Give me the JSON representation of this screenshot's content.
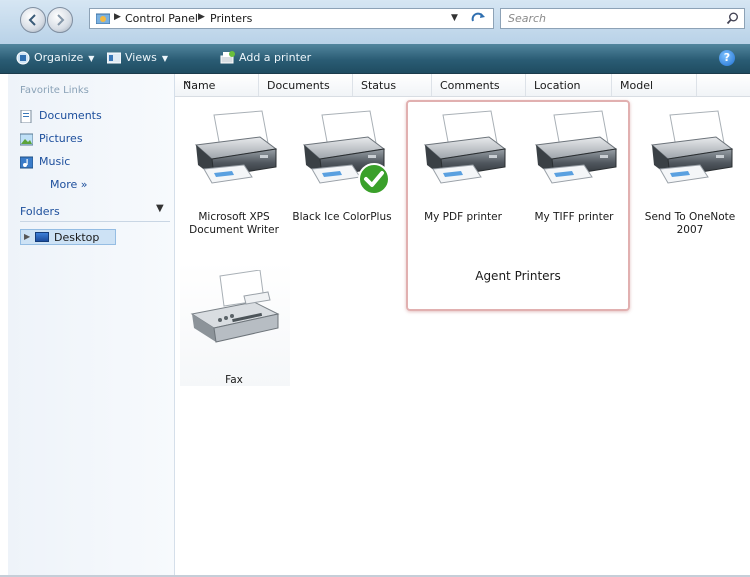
{
  "address_bar": {
    "breadcrumbs": [
      "Control Panel",
      "Printers"
    ],
    "search_placeholder": "Search"
  },
  "toolbar": {
    "organize_label": "Organize",
    "views_label": "Views",
    "add_printer_label": "Add a printer"
  },
  "nav_pane": {
    "favorite_links_header": "Favorite Links",
    "links": [
      {
        "label": "Documents",
        "icon": "documents-icon"
      },
      {
        "label": "Pictures",
        "icon": "pictures-icon"
      },
      {
        "label": "Music",
        "icon": "music-icon"
      }
    ],
    "more_label": "More »",
    "folders_header": "Folders",
    "tree_item": "Desktop"
  },
  "columns": [
    "Name",
    "Documents",
    "Status",
    "Comments",
    "Location",
    "Model"
  ],
  "printers": [
    {
      "name": "Microsoft XPS Document Writer",
      "line1": "Microsoft XPS",
      "line2": "Document Writer",
      "icon": "printer-icon"
    },
    {
      "name": "Black Ice ColorPlus",
      "line1": "Black Ice ColorPlus",
      "line2": "",
      "icon": "printer-icon",
      "default": true
    },
    {
      "name": "My PDF printer",
      "line1": "My PDF printer",
      "line2": "",
      "icon": "printer-icon"
    },
    {
      "name": "My TIFF printer",
      "line1": "My TIFF printer",
      "line2": "",
      "icon": "printer-icon"
    },
    {
      "name": "Send To OneNote 2007",
      "line1": "Send To OneNote",
      "line2": "2007",
      "icon": "printer-icon"
    },
    {
      "name": "Fax",
      "line1": "Fax",
      "line2": "",
      "icon": "fax-icon"
    }
  ],
  "annotation": {
    "label": "Agent Printers",
    "color": "#e1b0b0"
  },
  "colors": {
    "toolbar": "#2a5c74",
    "link": "#1c4e9c",
    "default_check": "#3aa02a"
  }
}
